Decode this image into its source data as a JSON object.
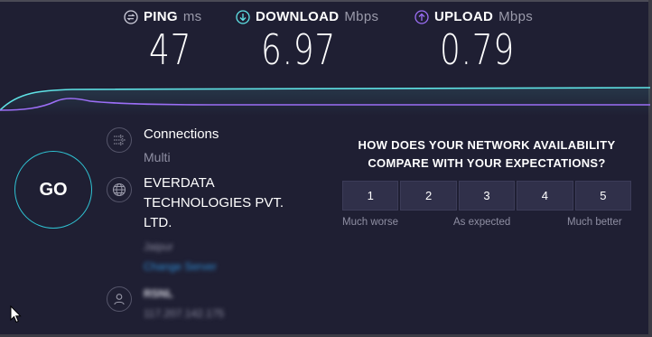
{
  "metrics": {
    "ping": {
      "label": "PING",
      "unit": "ms",
      "value": "47"
    },
    "download": {
      "label": "DOWNLOAD",
      "unit": "Mbps",
      "value": "6.97"
    },
    "upload": {
      "label": "UPLOAD",
      "unit": "Mbps",
      "value": "0.79"
    }
  },
  "colors": {
    "download_line": "#5fe3e6",
    "upload_line": "#9b6ef5",
    "go_ring": "#2fc3d3"
  },
  "go_label": "GO",
  "connections": {
    "title": "Connections",
    "value": "Multi",
    "icon": "connections-icon"
  },
  "provider": {
    "name": "EVERDATA TECHNOLOGIES PVT. LTD.",
    "icon": "globe-icon"
  },
  "server": {
    "location": "Jaipur",
    "change_label": "Change Server"
  },
  "user": {
    "name": "RSNL",
    "ip": "117.207.142.175",
    "icon": "user-icon"
  },
  "survey": {
    "question": "HOW DOES YOUR NETWORK AVAILABILITY COMPARE WITH YOUR EXPECTATIONS?",
    "options": [
      "1",
      "2",
      "3",
      "4",
      "5"
    ],
    "low_label": "Much worse",
    "mid_label": "As expected",
    "high_label": "Much better"
  }
}
